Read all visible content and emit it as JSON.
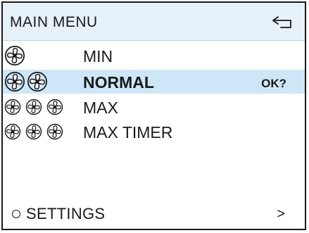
{
  "header": {
    "title": "MAIN MENU",
    "back_icon": "back-arrow-icon"
  },
  "menu": {
    "items": [
      {
        "label": "MIN",
        "fan_count": 1,
        "selected": false,
        "suffix": ""
      },
      {
        "label": "NORMAL",
        "fan_count": 2,
        "selected": true,
        "suffix": "OK?"
      },
      {
        "label": "MAX",
        "fan_count": 3,
        "selected": false,
        "suffix": ""
      },
      {
        "label": "MAX TIMER",
        "fan_count": 3,
        "selected": false,
        "suffix": ""
      }
    ]
  },
  "settings": {
    "label": "SETTINGS",
    "arrow": ">",
    "icon": "radio-circle-icon"
  },
  "colors": {
    "header_bg": "#e6f1f9",
    "selected_row_bg": "#cfe6f7",
    "text": "#1a1a1a"
  }
}
